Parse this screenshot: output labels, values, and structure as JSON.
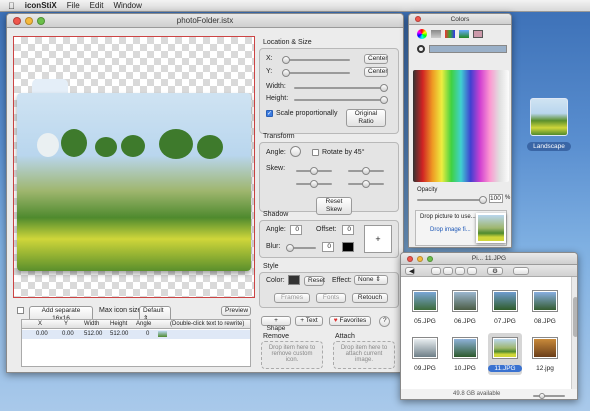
{
  "menubar": {
    "apple": "",
    "app": "iconStiX",
    "items": [
      "File",
      "Edit",
      "Window"
    ]
  },
  "main": {
    "title": "photoFolder.istx",
    "location": {
      "section": "Location & Size",
      "x_label": "X:",
      "y_label": "Y:",
      "center": "Center",
      "width_label": "Width:",
      "height_label": "Height:",
      "scale_label": "Scale proportionally",
      "original_ratio": "Original Ratio"
    },
    "transform": {
      "section": "Transform",
      "angle_label": "Angle:",
      "rotate_label": "Rotate by 45°",
      "skew_label": "Skew:",
      "reset_skew": "Reset Skew"
    },
    "shadow": {
      "section": "Shadow",
      "angle_label": "Angle:",
      "angle_value": "0",
      "offset_label": "Offset:",
      "offset_value": "0",
      "blur_label": "Blur:",
      "blur_value": "0",
      "plus": "+"
    },
    "style": {
      "section": "Style",
      "color_label": "Color:",
      "reset": "Reset",
      "effect_label": "Effect:",
      "effect_value": "None",
      "frames": "Frames",
      "fonts": "Fonts",
      "retouch": "Retouch"
    },
    "actions": {
      "shape": "+ Shape",
      "text": "+ Text",
      "favorites": "Favorites",
      "help": "?"
    },
    "remove": {
      "title": "Remove",
      "hint": "Drop item here to remove custom icon."
    },
    "attach": {
      "title": "Attach",
      "hint": "Drop item here to attach current image."
    },
    "bottom": {
      "add_separate": "Add separate 16x16",
      "max_icon_label": "Max icon size:",
      "max_icon_value": "Default",
      "preview": "Preview"
    },
    "table": {
      "headers": [
        "X",
        "Y",
        "Width",
        "Height",
        "Angle",
        "(Double-click text to rewrite)"
      ],
      "row": [
        "0.00",
        "0.00",
        "512.00",
        "512.00",
        "0"
      ]
    }
  },
  "colors": {
    "title": "Colors",
    "opacity_label": "Opacity",
    "opacity_value": "100",
    "opacity_unit": "%",
    "drop_hint": "Drop picture to use...",
    "drop_link": "Drop image fi..."
  },
  "finder": {
    "title": "Pi... 11.JPG",
    "status": "49.8 GB available",
    "files": [
      "05.JPG",
      "06.JPG",
      "07.JPG",
      "08.JPG",
      "09.JPG",
      "10.JPG",
      "11.JPG",
      "12.jpg"
    ]
  },
  "desktop": {
    "icon_label": "Landscape"
  }
}
